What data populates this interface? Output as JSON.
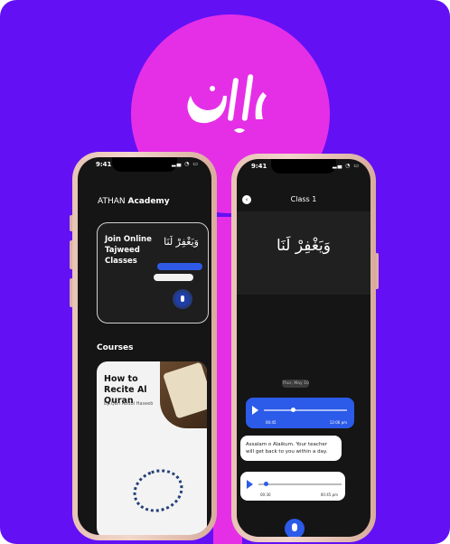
{
  "colors": {
    "background": "#6310f5",
    "circle": "#e52fe6",
    "accent_blue": "#2b5be8",
    "phone_frame": "#e9c6b8"
  },
  "logo": {
    "arabic_text": "اذان",
    "icon": "athan-calligraphy-logo"
  },
  "phone_left": {
    "status_time": "9:41",
    "brand": {
      "prefix": "ATHAN",
      "suffix": "Academy"
    },
    "promo": {
      "title": "Join Online Tajweed Classes",
      "arabic": "وَيَغْفِرْ لَنَا",
      "mic_icon": "microphone-icon"
    },
    "courses_label": "Courses",
    "course": {
      "title": "How to Recite Al Quran",
      "author": "by Qari Abdul Haseeb"
    }
  },
  "phone_right": {
    "status_time": "9:41",
    "back_icon": "back-arrow-icon",
    "title": "Class 1",
    "arabic": "وَيَغْفِرْ لَنَا",
    "day_chip": "Thur, May 10",
    "audio_sent": {
      "elapsed": "00:45",
      "time": "12:06 pm"
    },
    "message": "Assalam o Alaikum. Your teacher will get back to you within a day.",
    "audio_received": {
      "elapsed": "00:30",
      "time": "00:45 pm"
    },
    "mic_icon": "microphone-icon"
  }
}
